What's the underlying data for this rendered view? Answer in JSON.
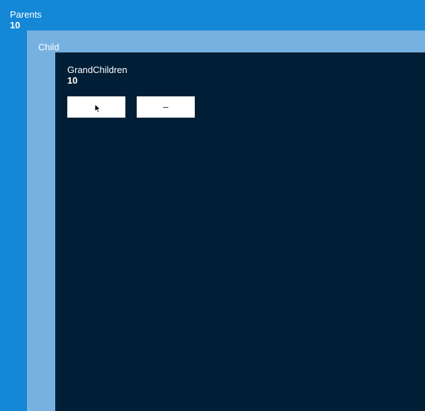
{
  "parents": {
    "title": "Parents",
    "count": "10"
  },
  "child": {
    "title": "Child"
  },
  "grandchildren": {
    "title": "GrandChildren",
    "count": "10",
    "increment_label": "",
    "decrement_label": "–"
  },
  "colors": {
    "parents_bg": "#1587d7",
    "child_bg": "#76b1e1",
    "grandchildren_bg": "#001f36",
    "button_bg": "#ffffff"
  },
  "icons": {
    "cursor": "mouse-pointer-icon"
  }
}
